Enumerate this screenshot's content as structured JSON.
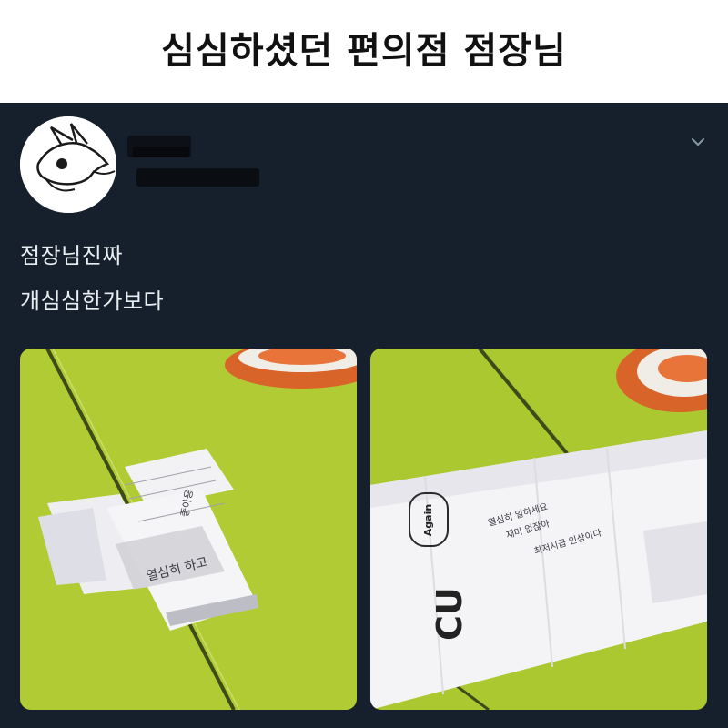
{
  "headline": {
    "text": "심심하셨던 편의점 점장님"
  },
  "tweet": {
    "author_name": "",
    "author_handle": "",
    "lines": [
      "점장님진짜",
      "개심심한가보다"
    ],
    "menu_icon": "chevron-down-icon"
  },
  "photos": {
    "left": {
      "note_top": "좋아용",
      "note_bottom": "열심히 하고"
    },
    "right": {
      "logo_text": "CU",
      "logo_bubble": "Again",
      "note_lines": [
        "열심히 일하세요",
        "재미 없잖아",
        "최저시급 인상이다"
      ]
    }
  },
  "colors": {
    "headline_bg": "#ffffff",
    "headline_text": "#111111",
    "tweet_bg": "#16202c",
    "tweet_text": "#e9eef2",
    "table_green": "#b5d232"
  }
}
